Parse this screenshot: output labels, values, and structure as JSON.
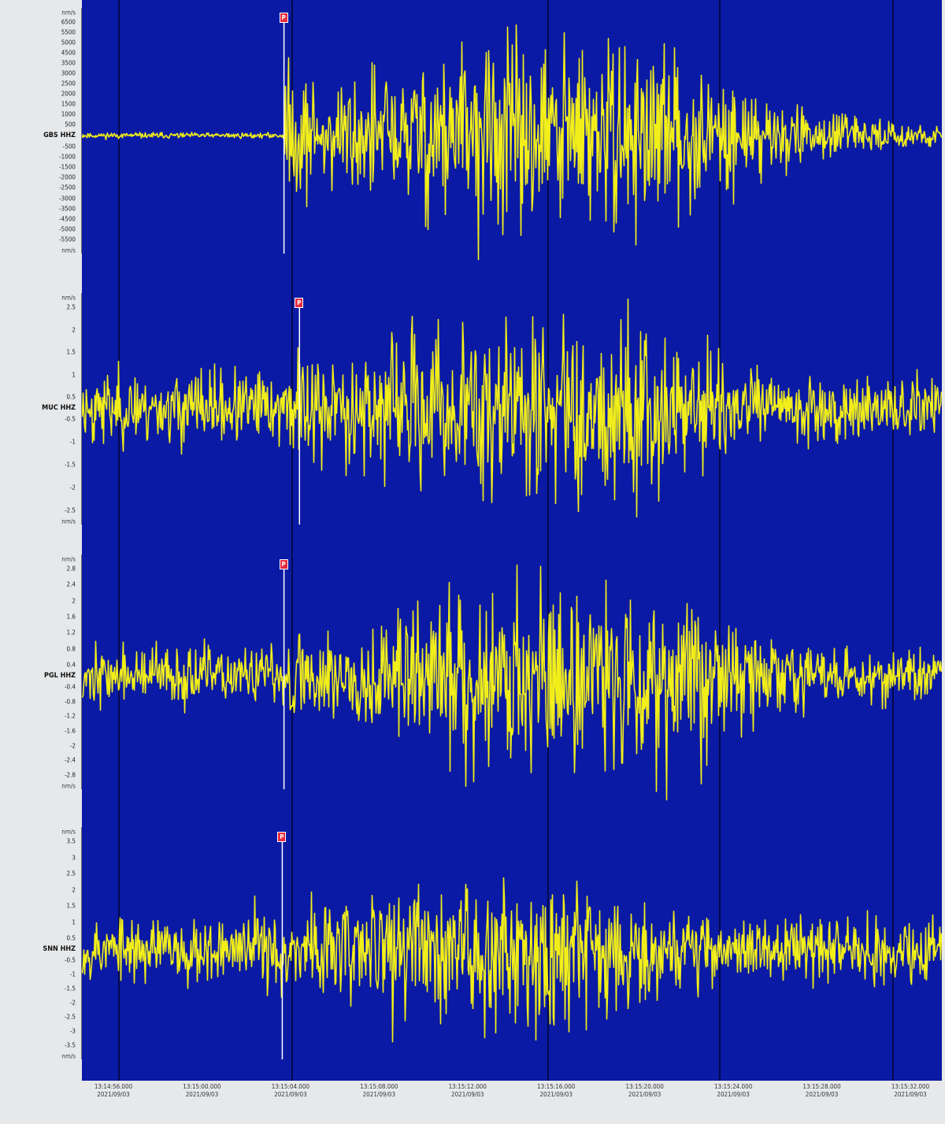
{
  "colors": {
    "background": "#0a1aa4",
    "trace": "#f2ee1a",
    "gridline": "#030a4a",
    "pick_line": "#ffffff",
    "pick_marker": "#e8283c"
  },
  "chart_data": {
    "type": "line",
    "title": "",
    "xlabel": "",
    "ylabel": "",
    "grid": true,
    "series": [
      {
        "name": "GBS HHZ",
        "y_ticks": [
          "6500",
          "5500",
          "5000",
          "4500",
          "3500",
          "3000",
          "2500",
          "2000",
          "1500",
          "1000",
          "500",
          "-500",
          "-1000",
          "-1500",
          "-2000",
          "-2500",
          "-3000",
          "-3500",
          "-4500",
          "-5000",
          "-5500"
        ],
        "y_unit": "nm/s",
        "pick": {
          "label": "P",
          "x": 0.235
        },
        "arrival": 0.235,
        "peak": 0.54,
        "noise": 0.03,
        "amplitude": 1.0,
        "seed": 11
      },
      {
        "name": "MUC HHZ",
        "y_ticks": [
          "2.5",
          "2",
          "1.5",
          "1",
          "0.5",
          "-0.5",
          "-1",
          "-1.5",
          "-2",
          "-2.5"
        ],
        "y_unit": "nm/s",
        "pick": {
          "label": "P",
          "x": 0.253
        },
        "arrival": 0.25,
        "peak": 0.54,
        "noise": 0.4,
        "amplitude": 0.95,
        "seed": 23
      },
      {
        "name": "PGL HHZ",
        "y_ticks": [
          "2.8",
          "2.4",
          "2",
          "1.6",
          "1.2",
          "0.8",
          "0.4",
          "-0.4",
          "-0.8",
          "-1.2",
          "-1.6",
          "-2",
          "-2.4",
          "-2.8"
        ],
        "y_unit": "nm/s",
        "pick": {
          "label": "P",
          "x": 0.235
        },
        "arrival": 0.24,
        "peak": 0.57,
        "noise": 0.3,
        "amplitude": 1.0,
        "seed": 37
      },
      {
        "name": "SNN HHZ",
        "y_ticks": [
          "3.5",
          "3",
          "2.5",
          "2",
          "1.5",
          "1",
          "0.5",
          "-0.5",
          "-1",
          "-1.5",
          "-2",
          "-2.5",
          "-3",
          "-3.5"
        ],
        "y_unit": "nm/s",
        "pick": {
          "label": "P",
          "x": 0.233
        },
        "arrival": 0.2,
        "peak": 0.5,
        "noise": 0.45,
        "amplitude": 0.75,
        "seed": 53
      }
    ],
    "x_ticks": [
      {
        "time": "13:14:56.000",
        "date": "2021/09/03"
      },
      {
        "time": "13:15:00.000",
        "date": "2021/09/03"
      },
      {
        "time": "13:15:04.000",
        "date": "2021/09/03"
      },
      {
        "time": "13:15:08.000",
        "date": "2021/09/03"
      },
      {
        "time": "13:15:12.000",
        "date": "2021/09/03"
      },
      {
        "time": "13:15:16.000",
        "date": "2021/09/03"
      },
      {
        "time": "13:15:20.000",
        "date": "2021/09/03"
      },
      {
        "time": "13:15:24.000",
        "date": "2021/09/03"
      },
      {
        "time": "13:15:28.000",
        "date": "2021/09/03"
      },
      {
        "time": "13:15:32.000",
        "date": "2021/09/03"
      }
    ]
  }
}
